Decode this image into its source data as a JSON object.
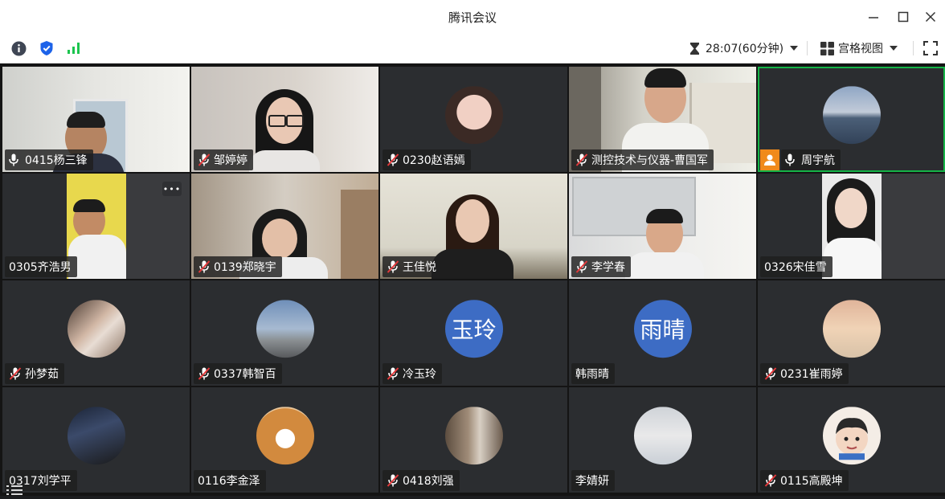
{
  "window": {
    "title": "腾讯会议",
    "controls": [
      "minimize-icon",
      "maximize-icon",
      "close-icon"
    ]
  },
  "toolbar": {
    "left_icons": [
      "info-icon",
      "shield-icon",
      "signal-icon"
    ],
    "timer_text": "28:07(60分钟)",
    "view_label": "宫格视图",
    "colors": {
      "info": "#3f4654",
      "shield": "#1d63e9",
      "signal": "#1cc44f"
    }
  },
  "participants": [
    {
      "name": "0415杨三锋",
      "mic": "on",
      "kind": "video",
      "scene": "room-white"
    },
    {
      "name": "邹婷婷",
      "mic": "muted",
      "kind": "video",
      "scene": "girl-glasses"
    },
    {
      "name": "0230赵语嫣",
      "mic": "muted",
      "kind": "avatar",
      "scene": "face-peach"
    },
    {
      "name": "测控技术与仪器-曹国军",
      "mic": "muted",
      "kind": "video",
      "scene": "boy-shelves"
    },
    {
      "name": "周宇航",
      "mic": "on",
      "kind": "avatar",
      "scene": "sea",
      "host": true,
      "active": true
    },
    {
      "name": "0305齐浩男",
      "mic": "none",
      "kind": "video",
      "scene": "yellow-wall",
      "more": "•••"
    },
    {
      "name": "0139郑晓宇",
      "mic": "muted",
      "kind": "video",
      "scene": "girl-room"
    },
    {
      "name": "王佳悦",
      "mic": "muted",
      "kind": "video",
      "scene": "girl-light"
    },
    {
      "name": "李学春",
      "mic": "muted",
      "kind": "video",
      "scene": "boy-whiteboard"
    },
    {
      "name": "0326宋佳雪",
      "mic": "none",
      "kind": "video",
      "scene": "girl-white"
    },
    {
      "name": "孙梦茹",
      "mic": "muted",
      "kind": "avatar",
      "scene": "girl-portrait"
    },
    {
      "name": "0337韩智百",
      "mic": "muted",
      "kind": "avatar",
      "scene": "street"
    },
    {
      "name": "冷玉玲",
      "mic": "muted",
      "kind": "text",
      "avatar_text": "玉玲"
    },
    {
      "name": "韩雨晴",
      "mic": "none",
      "kind": "text",
      "avatar_text": "雨晴"
    },
    {
      "name": "0231崔雨婷",
      "mic": "muted",
      "kind": "avatar",
      "scene": "dress"
    },
    {
      "name": "0317刘学平",
      "mic": "none",
      "kind": "avatar",
      "scene": "dark-room"
    },
    {
      "name": "0116李金泽",
      "mic": "none",
      "kind": "avatar",
      "scene": "shiba-dog"
    },
    {
      "name": "0418刘强",
      "mic": "muted",
      "kind": "avatar",
      "scene": "mirror-selfie"
    },
    {
      "name": "李婧妍",
      "mic": "none",
      "kind": "avatar",
      "scene": "girl-car"
    },
    {
      "name": "0115高殿坤",
      "mic": "muted",
      "kind": "avatar",
      "scene": "cartoon-boy"
    }
  ]
}
